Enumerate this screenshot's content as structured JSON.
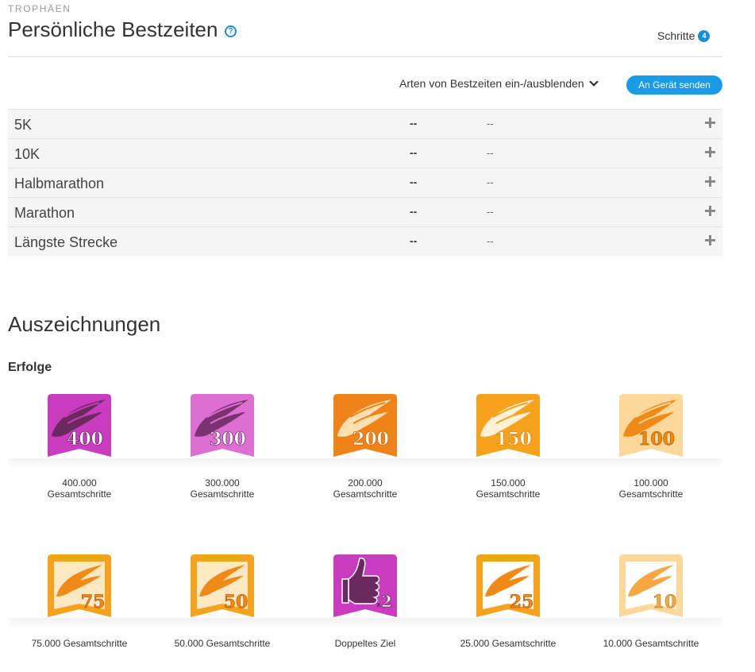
{
  "header": {
    "eyebrow": "TROPHÄEN",
    "title": "Persönliche Bestzeiten",
    "help": "?",
    "tab_label": "Schritte",
    "tab_count": "4"
  },
  "toolbar": {
    "toggle_label": "Arten von Bestzeiten ein-/ausblenden",
    "send_label": "An Gerät senden"
  },
  "records": [
    {
      "name": "5K",
      "time": "--",
      "date": "--"
    },
    {
      "name": "10K",
      "time": "--",
      "date": "--"
    },
    {
      "name": "Halbmarathon",
      "time": "--",
      "date": "--"
    },
    {
      "name": "Marathon",
      "time": "--",
      "date": "--"
    },
    {
      "name": "Längste Strecke",
      "time": "--",
      "date": "--"
    }
  ],
  "awards": {
    "title": "Auszeichnungen",
    "section": "Erfolge",
    "badges": [
      {
        "number": "400",
        "caption1": "400.000",
        "caption2": "Gesamtschritte",
        "color": "#c93cbf",
        "wing": "#6b2a5e",
        "kind": "wing"
      },
      {
        "number": "300",
        "caption1": "300.000",
        "caption2": "Gesamtschritte",
        "color": "#dd6fd2",
        "wing": "#7a3270",
        "kind": "wing"
      },
      {
        "number": "200",
        "caption1": "200.000",
        "caption2": "Gesamtschritte",
        "color": "#ef8318",
        "wing": "#fde0b0",
        "kind": "wing"
      },
      {
        "number": "150",
        "caption1": "150.000",
        "caption2": "Gesamtschritte",
        "color": "#f7a21c",
        "wing": "#fff1d6",
        "kind": "wing"
      },
      {
        "number": "100",
        "caption1": "100.000",
        "caption2": "Gesamtschritte",
        "color": "#fcd89a",
        "wing": "#f08a17",
        "kind": "wing-light"
      },
      {
        "number": "75",
        "caption1": "75.000 Gesamtschritte",
        "caption2": "",
        "color": "#f7a21c",
        "wing": "#f08a17",
        "kind": "frame"
      },
      {
        "number": "50",
        "caption1": "50.000 Gesamtschritte",
        "caption2": "",
        "color": "#f7a21c",
        "wing": "#f08a17",
        "kind": "frame"
      },
      {
        "number": "2",
        "caption1": "Doppeltes Ziel",
        "caption2": "",
        "color": "#c93cbf",
        "wing": "#6b2a5e",
        "kind": "thumb"
      },
      {
        "number": "25",
        "caption1": "25.000 Gesamtschritte",
        "caption2": "",
        "color": "#f7a21c",
        "wing": "#f08a17",
        "kind": "frame"
      },
      {
        "number": "10",
        "caption1": "10.000 Gesamtschritte",
        "caption2": "",
        "color": "#fcd89a",
        "wing": "#f08a17",
        "kind": "frame-light"
      }
    ]
  }
}
